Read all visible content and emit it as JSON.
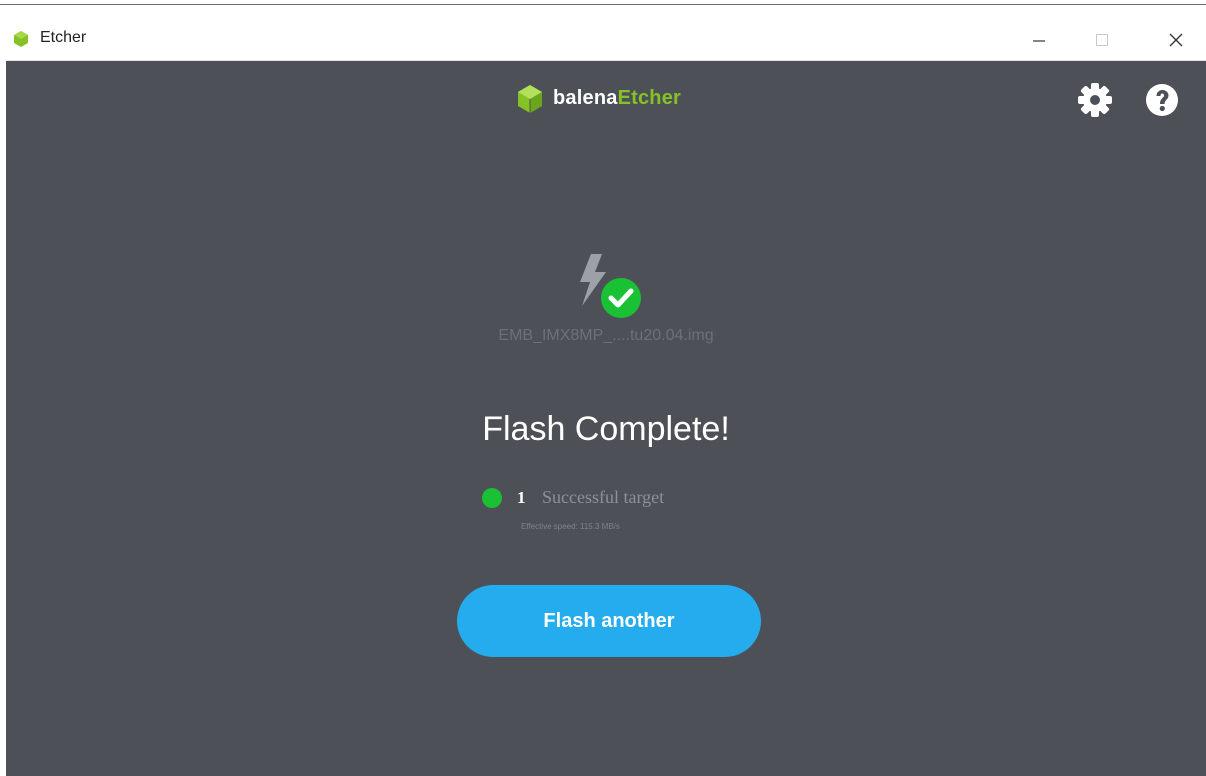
{
  "window": {
    "title": "Etcher",
    "controls": [
      "minimize",
      "maximize",
      "close"
    ]
  },
  "header": {
    "brand_prefix": "balena",
    "brand_suffix": "Etcher",
    "icons": [
      "settings-gear-icon",
      "help-icon"
    ]
  },
  "main": {
    "image_filename": "EMB_IMX8MP_....tu20.04.img",
    "headline": "Flash Complete!",
    "result": {
      "count": "1",
      "label": "Successful target"
    },
    "speed_text": "Effective speed: 115.3 MB/s",
    "action_button": "Flash another"
  },
  "colors": {
    "background": "#4d5057",
    "brand_green": "#85c226",
    "success_green": "#1ac135",
    "button_blue": "#24acef"
  }
}
